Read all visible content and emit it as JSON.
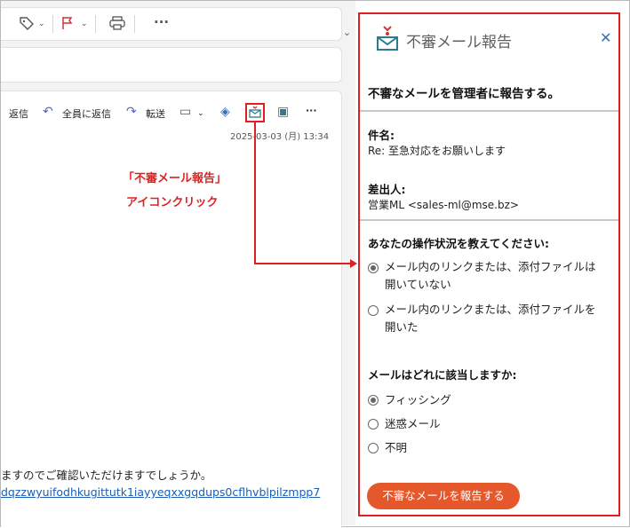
{
  "toolbar": {
    "tag_icon": "tag-icon",
    "flag_icon": "flag-icon",
    "print_icon": "print-icon",
    "more": "···"
  },
  "mail": {
    "actions": {
      "reply": "返信",
      "reply_all": "全員に返信",
      "forward": "転送"
    },
    "date": "2025-03-03 (月) 13:34",
    "body_line": "ますのでご確認いただけますでしょうか。",
    "body_link": "dqzzwyuifodhkugittutk1iayyeqxxgqdups0cflhvblpilzmpp7"
  },
  "annotation": {
    "line1": "「不審メール報告」",
    "line2": "アイコンクリック"
  },
  "panel": {
    "title": "不審メール報告",
    "close": "✕",
    "subtitle": "不審なメールを管理者に報告する。",
    "subject_label": "件名:",
    "subject_value": "Re: 至急対応をお願いします",
    "sender_label": "差出人:",
    "sender_value": "営業ML <sales-ml@mse.bz>",
    "q1": "あなたの操作状況を教えてください:",
    "q1_options": [
      {
        "line1": "メール内のリンクまたは、添付ファイルは",
        "line2": "開いていない",
        "selected": true
      },
      {
        "line1": "メール内のリンクまたは、添付ファイルを",
        "line2": "開いた",
        "selected": false
      }
    ],
    "q2": "メールはどれに該当しますか:",
    "q2_options": [
      {
        "label": "フィッシング",
        "selected": true
      },
      {
        "label": "迷惑メール",
        "selected": false
      },
      {
        "label": "不明",
        "selected": false
      }
    ],
    "submit": "不審なメールを報告する"
  },
  "colors": {
    "highlight": "#e02020",
    "accent": "#e4582c",
    "outlook_purple": "#5b5fc7"
  }
}
